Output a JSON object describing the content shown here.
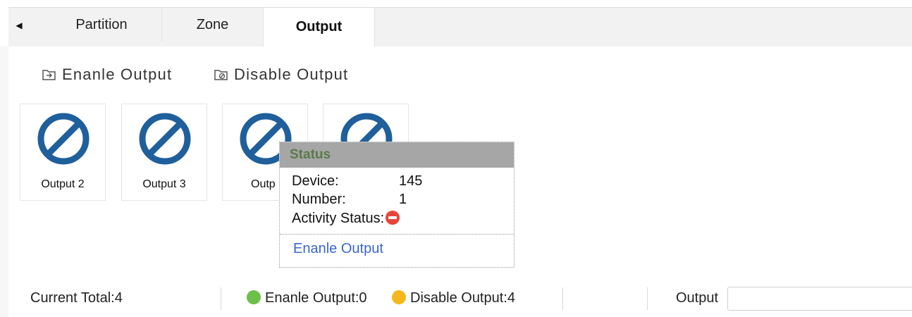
{
  "tabs": [
    {
      "label": "Partition"
    },
    {
      "label": "Zone"
    },
    {
      "label": "Output",
      "active": true
    }
  ],
  "toolbar": {
    "enable_label": "Enanle Output",
    "disable_label": "Disable Output"
  },
  "cards": [
    {
      "label": "Output 2"
    },
    {
      "label": "Output 3"
    },
    {
      "label": "Outp"
    },
    {
      "label": ""
    }
  ],
  "popup": {
    "title": "Status",
    "device_label": "Device:",
    "device_value": "145",
    "number_label": "Number:",
    "number_value": "1",
    "activity_label": "Activity Status:",
    "action_link": "Enanle Output"
  },
  "footer": {
    "total": "Current Total:4",
    "enable_legend": "Enanle Output:0",
    "disable_legend": "Disable Output:4",
    "search_label": "Output",
    "search_value": ""
  },
  "colors": {
    "output_icon": "#1f5f9b",
    "enable_dot": "#6cc04a",
    "disable_dot": "#f5b81c",
    "status_error": "#e8453a",
    "link": "#3a67c9"
  },
  "icons": {
    "tab_scroll": "triangle-left-icon",
    "enable": "enable-output-icon",
    "disable": "disable-output-icon",
    "output_state": "prohibited-icon",
    "activity_status": "minus-circle-icon"
  }
}
